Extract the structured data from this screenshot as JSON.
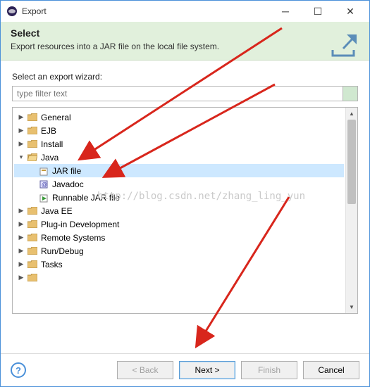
{
  "title": "Export",
  "banner": {
    "heading": "Select",
    "description": "Export resources into a JAR file on the local file system."
  },
  "wizard_label": "Select an export wizard:",
  "filter_placeholder": "type filter text",
  "tree": {
    "items": [
      "General",
      "EJB",
      "Install",
      "Java",
      "Java EE",
      "Plug-in Development",
      "Remote Systems",
      "Run/Debug",
      "Tasks"
    ],
    "java_children": {
      "jar": "JAR file",
      "javadoc": "Javadoc",
      "runnable": "Runnable JAR file"
    }
  },
  "watermark": "http://blog.csdn.net/zhang_ling_yun",
  "buttons": {
    "back": "< Back",
    "next": "Next >",
    "finish": "Finish",
    "cancel": "Cancel"
  }
}
